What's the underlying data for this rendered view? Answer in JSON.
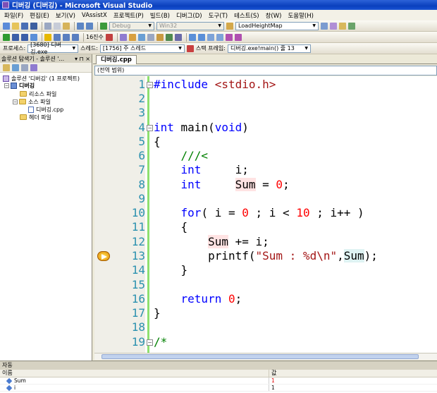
{
  "window": {
    "title": "디버깅 (디버깅) - Microsoft Visual Studio"
  },
  "menu": [
    "파일(F)",
    "편집(E)",
    "보기(V)",
    "VAssistX",
    "프로젝트(P)",
    "빌드(B)",
    "디버그(D)",
    "도구(T)",
    "테스트(S)",
    "창(W)",
    "도움말(H)"
  ],
  "toolbar1": {
    "config": "Debug",
    "platform": "Win32",
    "find": "LoadHeightMap"
  },
  "toolbar2": {
    "hex_label": "16진수"
  },
  "toolbar3": {
    "process_label": "프로세스:",
    "process_value": "[3680] 디버깅.exe",
    "thread_label": "스레드:",
    "thread_value": "[1756] 주 스레드",
    "frame_label": "스택 프레임:",
    "frame_value": "디버깅.exe!main()  줄 13"
  },
  "solution": {
    "header": "솔루션 탐색기 - 솔루션 '...",
    "header_btns": "▾ ⊓ ×",
    "solution_item": "솔루션 '디버깅' (1 프로젝트)",
    "project_item": "디버깅",
    "folder_resource": "리소스 파일",
    "folder_source": "소스 파일",
    "file_cpp": "디버깅.cpp",
    "folder_header": "헤더 파일"
  },
  "editor": {
    "tab": "디버깅.cpp",
    "scope": "(전역 범위)",
    "current_line": 13,
    "line_numbers": [
      "1",
      "2",
      "3",
      "4",
      "5",
      "6",
      "7",
      "8",
      "9",
      "10",
      "11",
      "12",
      "13",
      "14",
      "15",
      "16",
      "17",
      "18",
      "19"
    ]
  },
  "autos": {
    "title": "자동",
    "col_name": "이름",
    "col_value": "값",
    "rows": [
      {
        "name": "Sum",
        "value": "1"
      },
      {
        "name": "i",
        "value": "1"
      }
    ]
  }
}
